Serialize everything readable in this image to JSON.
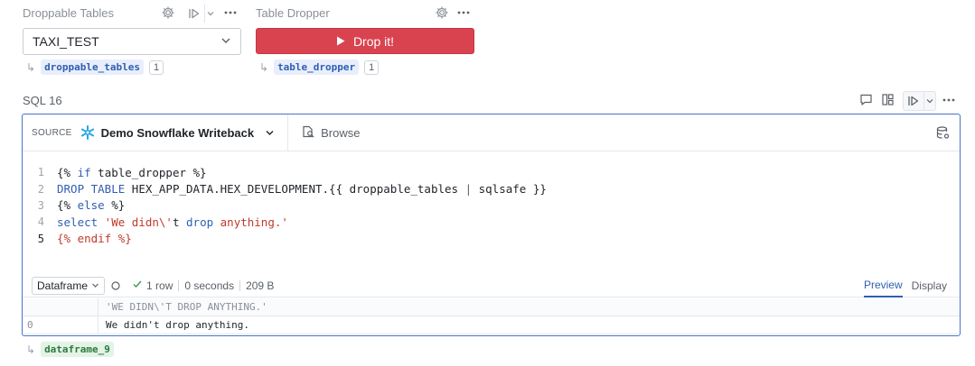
{
  "cells": {
    "droppable": {
      "title": "Droppable Tables",
      "selected": "TAXI_TEST",
      "var_name": "droppable_tables",
      "ref_count": "1"
    },
    "dropper": {
      "title": "Table Dropper",
      "button_label": "Drop it!",
      "var_name": "table_dropper",
      "ref_count": "1"
    }
  },
  "sql_cell": {
    "title": "SQL 16",
    "source_label": "SOURCE",
    "connection": "Demo Snowflake Writeback",
    "browse_label": "Browse",
    "code_lines": [
      {
        "num": "1"
      },
      {
        "num": "2"
      },
      {
        "num": "3"
      },
      {
        "num": "4"
      },
      {
        "num": "5"
      }
    ],
    "code": {
      "l1_a": "{% ",
      "l1_b": "if",
      "l1_c": " table_dropper %}",
      "l2_a": "DROP TABLE",
      "l2_b": " HEX_APP_DATA.HEX_DEVELOPMENT.",
      "l2_c": "{{",
      "l2_d": " droppable_tables ",
      "l2_e": "|",
      "l2_f": " sqlsafe ",
      "l2_g": "}}",
      "l3_a": "{% ",
      "l3_b": "else",
      "l3_c": " %}",
      "l4_a": "select",
      "l4_b": " 'We didn\\'",
      "l4_c": "t ",
      "l4_d": "drop",
      "l4_e": " anything.'",
      "l5": "{% endif %}"
    },
    "result": {
      "output_type": "Dataframe",
      "rows": "1 row",
      "time": "0 seconds",
      "size": "209 B",
      "tab_preview": "Preview",
      "tab_display": "Display",
      "column_header": "'WE DIDN\\'T DROP ANYTHING.'",
      "row_index": "0",
      "row_value": "We didn't drop anything."
    },
    "output_var": "dataframe_9"
  },
  "colors": {
    "accent": "#2f5fb3",
    "danger": "#d9434f",
    "focus_border": "#4a72c9"
  }
}
